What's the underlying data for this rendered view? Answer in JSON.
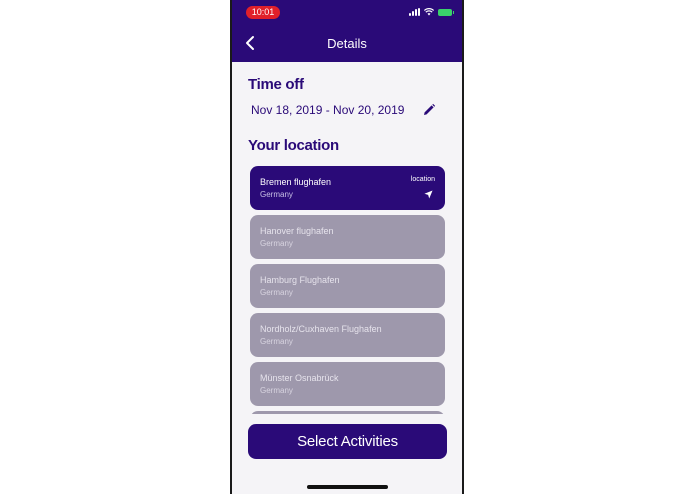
{
  "status_bar": {
    "time": "10:01"
  },
  "header": {
    "title": "Details"
  },
  "time_off": {
    "title": "Time off",
    "date_range": "Nov 18, 2019 - Nov 20, 2019"
  },
  "location": {
    "title": "Your location",
    "items": [
      {
        "name": "Bremen flughafen",
        "country": "Germany",
        "tag": "location",
        "selected": true
      },
      {
        "name": "Hanover flughafen",
        "country": "Germany"
      },
      {
        "name": "Hamburg Flughafen",
        "country": "Germany"
      },
      {
        "name": "Nordholz/Cuxhaven Flughafen",
        "country": "Germany"
      },
      {
        "name": "Münster Osnabrück",
        "country": "Germany"
      }
    ]
  },
  "footer": {
    "cta_label": "Select Activities"
  },
  "colors": {
    "primary": "#2a0a78",
    "inactive_card": "#9e98ac",
    "background": "#f5f4f7"
  }
}
